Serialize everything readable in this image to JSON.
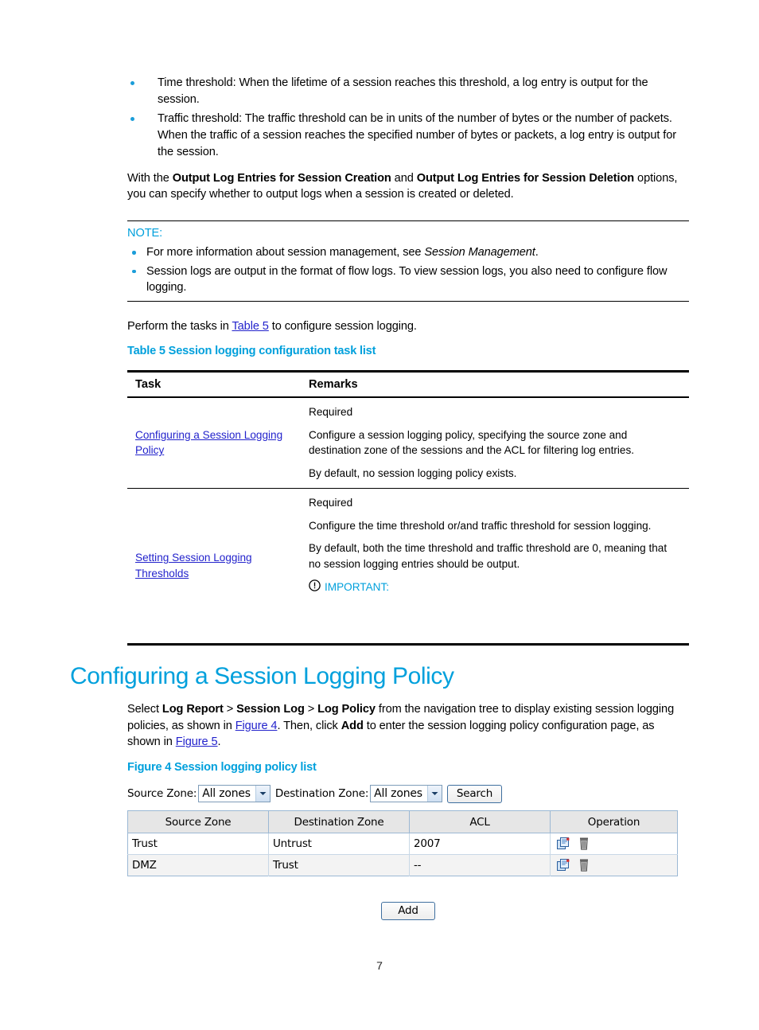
{
  "theme": {
    "accent": "#00a0dc",
    "link": "#2323cc",
    "bullet": "#1b9dd9",
    "text": "#000000"
  },
  "intro": {
    "bullets": [
      {
        "lead": "Time threshold:",
        "rest": " When the lifetime of a session reaches this threshold, a log entry is output for the session."
      },
      {
        "lead": "Traffic threshold:",
        "rest": " The traffic threshold can be in units of the number of bytes or the number of packets. When the traffic of a session reaches the specified number of bytes or packets, a log entry is output for the session."
      }
    ],
    "paragraph": {
      "part1": "With the ",
      "bold1": "Output Log Entries for Session Creation",
      "part2": " and ",
      "bold2": "Output Log Entries for Session Deletion",
      "part3": " options, you can specify whether to output logs when a session is created or deleted."
    }
  },
  "note": {
    "label": "NOTE:",
    "items": [
      {
        "text": "For more information about session management, see ",
        "italic": "Session Management",
        "tail": "."
      },
      {
        "text": "Session logs are output in the format of flow logs. To view session logs, you also need to configure flow logging.",
        "italic": "",
        "tail": ""
      }
    ]
  },
  "perform": {
    "before": "Perform the tasks in ",
    "link": "Table 5",
    "after": " to configure session logging."
  },
  "table5": {
    "caption": "Table 5 Session logging configuration task list",
    "headers": [
      "Task",
      "Remarks"
    ],
    "rows": [
      {
        "task_link": "Configuring a Session Logging Policy",
        "remarks": [
          "Required",
          "Configure a session logging policy, specifying the source zone and destination zone of the sessions and the ACL for filtering log entries.",
          "By default, no session logging policy exists."
        ],
        "important": null
      },
      {
        "task_link": "Setting Session Logging Thresholds",
        "remarks": [
          "Required",
          "Configure the time threshold or/and traffic threshold for session logging.",
          "By default, both the time threshold and traffic threshold are 0, meaning that no session logging entries should be output."
        ],
        "important": "IMPORTANT:"
      }
    ]
  },
  "section": {
    "heading": "Configuring a Session Logging Policy",
    "paragraph": {
      "p1": "Select ",
      "b1": "Log Report",
      "sep1": " > ",
      "b2": "Session Log",
      "sep2": " > ",
      "b3": "Log Policy",
      "p2": " from the navigation tree to display existing session logging policies, as shown in ",
      "link1": "Figure 4",
      "p3": ". Then, click ",
      "b4": "Add",
      "p4": " to enter the session logging policy configuration page, as shown in ",
      "link2": "Figure 5",
      "p5": "."
    }
  },
  "figure4": {
    "caption": "Figure 4 Session logging policy list",
    "filters": {
      "source_zone_label": "Source Zone:",
      "source_zone_value": "All zones",
      "destination_zone_label": "Destination Zone:",
      "destination_zone_value": "All zones",
      "search_button": "Search"
    },
    "table": {
      "headers": [
        "Source Zone",
        "Destination Zone",
        "ACL",
        "Operation"
      ],
      "rows": [
        {
          "source_zone": "Trust",
          "destination_zone": "Untrust",
          "acl": "2007"
        },
        {
          "source_zone": "DMZ",
          "destination_zone": "Trust",
          "acl": "--"
        }
      ],
      "operation_icons": [
        "edit-icon",
        "delete-icon"
      ]
    },
    "add_button": "Add"
  },
  "page_number": "7"
}
